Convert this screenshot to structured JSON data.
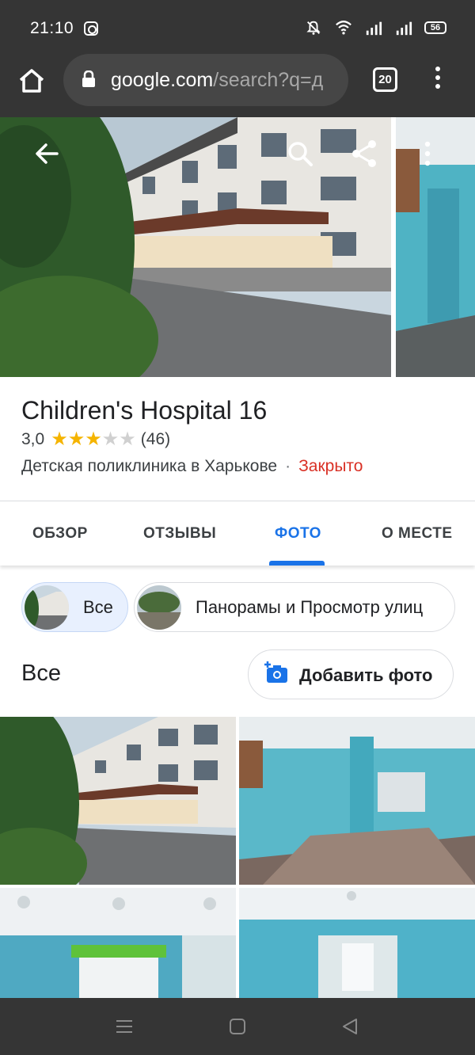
{
  "status_bar": {
    "time": "21:10",
    "battery": "56"
  },
  "browser": {
    "url_host": "google.com",
    "url_rest": "/search?q=д",
    "tab_count": "20"
  },
  "place": {
    "name": "Children's Hospital 16",
    "rating": "3,0",
    "rating_stars": 3,
    "review_count": "(46)",
    "category": "Детская поликлиника в Харькове",
    "separator": "·",
    "status": "Закрыто"
  },
  "tabs": [
    {
      "label": "ОБЗОР",
      "active": false
    },
    {
      "label": "ОТЗЫВЫ",
      "active": false
    },
    {
      "label": "ФОТО",
      "active": true
    },
    {
      "label": "О МЕСТЕ",
      "active": false
    }
  ],
  "chips": [
    {
      "label": "Все",
      "selected": true
    },
    {
      "label": "Панорамы и Просмотр улиц",
      "selected": false
    }
  ],
  "photos_section": {
    "title": "Все",
    "add_photo_label": "Добавить фото"
  },
  "colors": {
    "accent": "#1a73e8",
    "closed": "#d93025",
    "star": "#f5b400",
    "chrome": "#353535"
  }
}
